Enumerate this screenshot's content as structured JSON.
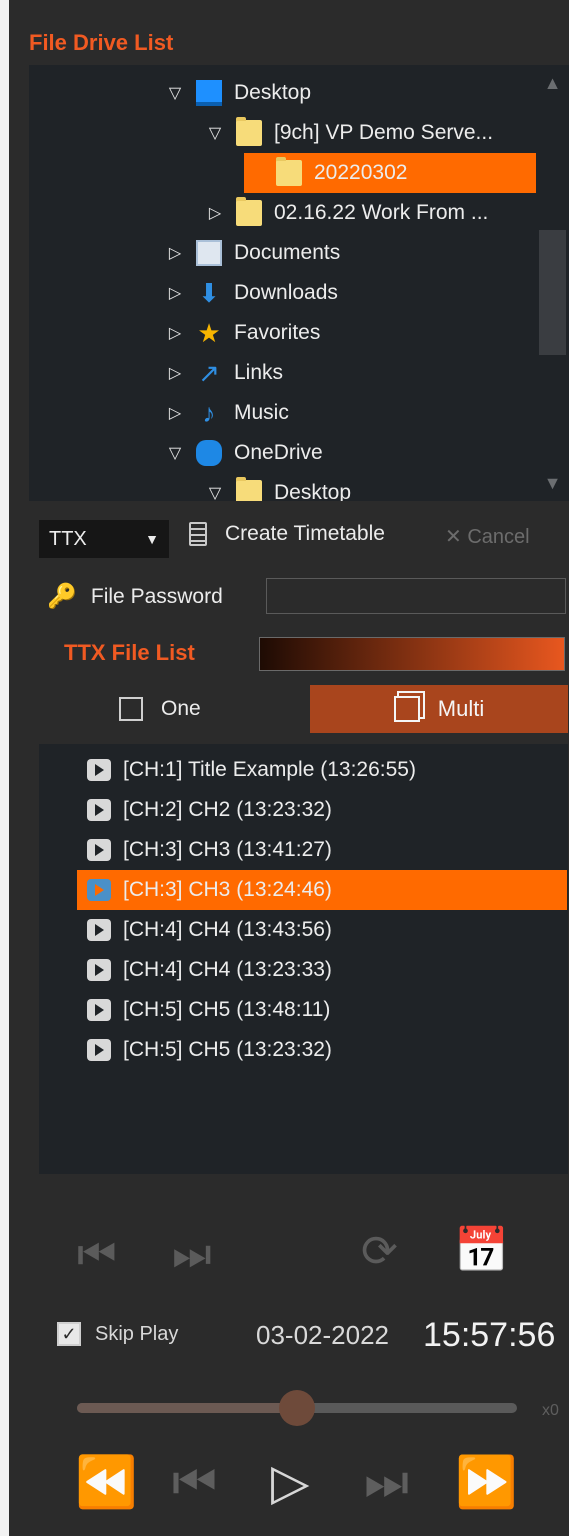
{
  "drive_panel": {
    "title": "File Drive List"
  },
  "tree": [
    {
      "label": "Desktop",
      "arrow": "▽",
      "icon": "desktop-icon",
      "indent": 0,
      "selected": false
    },
    {
      "label": "[9ch] VP Demo Serve...",
      "arrow": "▽",
      "icon": "folder-icon",
      "indent": 1,
      "selected": false
    },
    {
      "label": "20220302",
      "arrow": "",
      "icon": "folder-icon",
      "indent": 2,
      "selected": true
    },
    {
      "label": "02.16.22 Work From ...",
      "arrow": "▷",
      "icon": "folder-icon",
      "indent": 1,
      "selected": false
    },
    {
      "label": "Documents",
      "arrow": "▷",
      "icon": "documents-icon",
      "indent": 0,
      "selected": false
    },
    {
      "label": "Downloads",
      "arrow": "▷",
      "icon": "download-arrow-icon",
      "indent": 0,
      "selected": false
    },
    {
      "label": "Favorites",
      "arrow": "▷",
      "icon": "star-icon",
      "indent": 0,
      "selected": false
    },
    {
      "label": "Links",
      "arrow": "▷",
      "icon": "link-arrow-icon",
      "indent": 0,
      "selected": false
    },
    {
      "label": "Music",
      "arrow": "▷",
      "icon": "music-note-icon",
      "indent": 0,
      "selected": false
    },
    {
      "label": "OneDrive",
      "arrow": "▽",
      "icon": "cloud-icon",
      "indent": 0,
      "selected": false
    },
    {
      "label": "Desktop",
      "arrow": "▽",
      "icon": "folder-icon",
      "indent": 1,
      "selected": false
    }
  ],
  "tree_scroll": {
    "up": "▲",
    "down": "▼"
  },
  "ttx_controls": {
    "format_value": "TTX",
    "format_chevron": "▼",
    "create_label": "Create Timetable",
    "cancel_label": "✕ Cancel",
    "password_label": "File Password",
    "password_value": ""
  },
  "ttx_panel": {
    "title": "TTX File List",
    "one_label": "One",
    "multi_label": "Multi",
    "one_checked": false
  },
  "ttx_files": [
    {
      "label": "[CH:1] Title Example (13:26:55)",
      "selected": false
    },
    {
      "label": "[CH:2] CH2 (13:23:32)",
      "selected": false
    },
    {
      "label": "[CH:3] CH3 (13:41:27)",
      "selected": false
    },
    {
      "label": "[CH:3] CH3 (13:24:46)",
      "selected": true
    },
    {
      "label": "[CH:4] CH4 (13:43:56)",
      "selected": false
    },
    {
      "label": "[CH:4] CH4 (13:23:33)",
      "selected": false
    },
    {
      "label": "[CH:5] CH5 (13:48:11)",
      "selected": false
    },
    {
      "label": "[CH:5] CH5 (13:23:32)",
      "selected": false
    }
  ],
  "transport": {
    "skip_play_label": "Skip Play",
    "skip_play_checked": "✓",
    "date": "03-02-2022",
    "time": "15:57:56",
    "speed_label": "x0",
    "slider_position": 0.5
  },
  "colors": {
    "accent": "#f15a22",
    "selection": "#ff6a00",
    "panel_bg": "#2b2b2b",
    "list_bg": "#1f2327",
    "multi_button": "#a9451d"
  }
}
